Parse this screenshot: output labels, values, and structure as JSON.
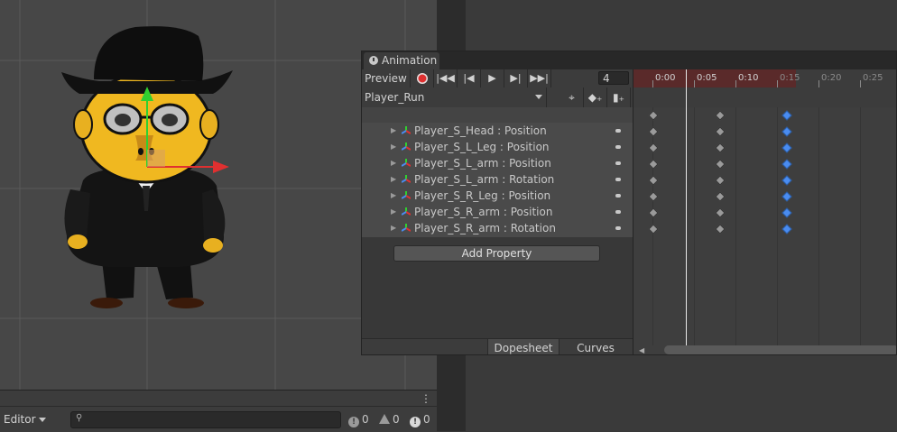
{
  "console": {
    "editor_label": "Editor",
    "search_placeholder": "",
    "info_count": "0",
    "warning_count": "0",
    "error_count": "0"
  },
  "animation": {
    "tab_title": "Animation",
    "preview_label": "Preview",
    "frame_value": "4",
    "clip_name": "Player_Run",
    "properties": [
      {
        "label": "Player_S_Head : Position"
      },
      {
        "label": "Player_S_L_Leg : Position"
      },
      {
        "label": "Player_S_L_arm : Position"
      },
      {
        "label": "Player_S_L_arm : Rotation"
      },
      {
        "label": "Player_S_R_Leg : Position"
      },
      {
        "label": "Player_S_R_arm : Position"
      },
      {
        "label": "Player_S_R_arm : Rotation"
      }
    ],
    "add_property_label": "Add Property",
    "dopesheet_label": "Dopesheet",
    "curves_label": "Curves",
    "ruler_labels": [
      "0:00",
      "0:05",
      "0:10",
      "0:15",
      "0:20",
      "0:25"
    ],
    "keyframe_times": [
      "0:00",
      "0:05",
      "0:10"
    ],
    "selected_keyframe_time": "0:10",
    "current_frame": 4
  },
  "icons": {
    "record": "record-icon",
    "first_key": "first-key-icon",
    "prev_key": "prev-key-icon",
    "play": "play-icon",
    "next_key": "next-key-icon",
    "last_key": "last-key-icon",
    "add_keyframe": "add-keyframe-icon",
    "add_event": "add-event-icon",
    "filter": "filter-icon"
  },
  "colors": {
    "record": "#e03030",
    "selected_key": "#4a8cf0",
    "gizmo_x": "#e03030",
    "gizmo_y": "#30d030"
  }
}
